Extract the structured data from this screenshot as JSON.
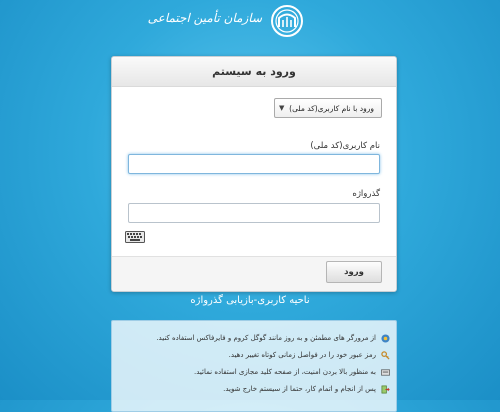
{
  "brand": {
    "name": "سازمان تأمین اجتماعی",
    "emblem_icon": "social-security-emblem",
    "text_color": "#ffffff"
  },
  "login_form": {
    "title": "ورود به سیستم",
    "login_type": {
      "selected": "ورود با نام کاربری(کد ملی)"
    },
    "username": {
      "label": "نام کاربری(کد ملی)",
      "value": ""
    },
    "password": {
      "label": "گذرواژه",
      "value": ""
    },
    "keyboard_icon": "virtual-keyboard-icon",
    "submit_label": "ورود"
  },
  "recover_link": "ناحیه کاربری-بازیابی گذرواژه",
  "tips": [
    {
      "icon": "browser-icon",
      "text": "از مرورگر های مطمئن و به روز مانند گوگل کروم و فایرفاکس استفاده کنید."
    },
    {
      "icon": "password-change-icon",
      "text": "رمز عبور خود را در فواصل زمانی کوتاه تغییر دهید."
    },
    {
      "icon": "keyboard-icon",
      "text": "به منظور بالا بردن امنیت، از صفحه کلید مجازی استفاده نمائید."
    },
    {
      "icon": "exit-icon",
      "text": "پس از انجام و اتمام کار، حتما از سیستم خارج شوید."
    }
  ],
  "colors": {
    "background": "#2fa9db",
    "card_border": "#c9cfd4",
    "input_focus": "#7fb6dd"
  }
}
